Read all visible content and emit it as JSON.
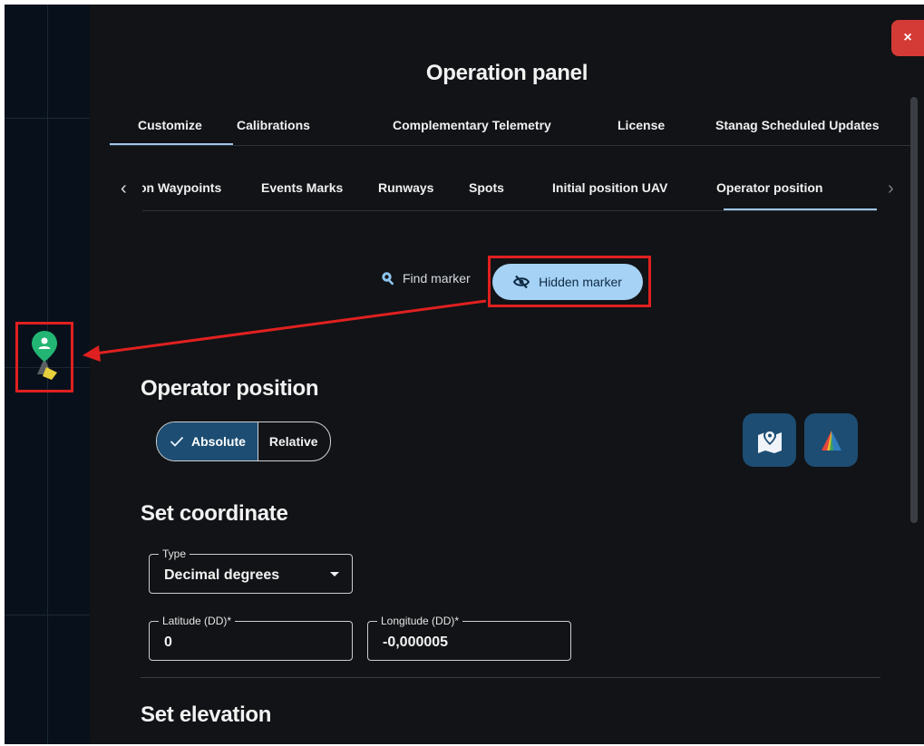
{
  "panel": {
    "title": "Operation panel",
    "close_label": "×"
  },
  "main_tabs": [
    {
      "label": "Customize",
      "selected": true
    },
    {
      "label": "Calibrations",
      "selected": false
    },
    {
      "label": "Complementary Telemetry",
      "selected": false
    },
    {
      "label": "License",
      "selected": false
    },
    {
      "label": "Stanag Scheduled Updates",
      "selected": false
    }
  ],
  "sub_tabs": [
    {
      "label": "on Waypoints",
      "selected": false
    },
    {
      "label": "Events Marks",
      "selected": false
    },
    {
      "label": "Runways",
      "selected": false
    },
    {
      "label": "Spots",
      "selected": false
    },
    {
      "label": "Initial position UAV",
      "selected": false
    },
    {
      "label": "Operator position",
      "selected": true
    }
  ],
  "sub_tabs_nav": {
    "prev": "‹",
    "next": "›"
  },
  "marker_actions": {
    "find_label": "Find marker",
    "hidden_label": "Hidden marker"
  },
  "operator": {
    "heading": "Operator position",
    "mode_options": [
      "Absolute",
      "Relative"
    ],
    "selected_mode": "Absolute"
  },
  "coordinate": {
    "heading": "Set coordinate",
    "type_label": "Type",
    "type_value": "Decimal degrees",
    "latitude_label": "Latitude (DD)*",
    "latitude_value": "0",
    "longitude_label": "Longitude (DD)*",
    "longitude_value": "-0,000005"
  },
  "elevation": {
    "heading": "Set elevation"
  },
  "colors": {
    "accent": "#a5d2f5",
    "selected_bg": "#1d4d72",
    "panel_bg": "#111316",
    "map_bg": "#08101b",
    "highlight": "#e02020",
    "marker": "#22b573"
  },
  "icons": {
    "find": "search-icon",
    "hidden": "eye-off-icon",
    "map_button": "map-pin-icon",
    "logo_button": "triangle-logo-icon",
    "map_marker": "operator-pin-icon",
    "check": "check-icon"
  }
}
